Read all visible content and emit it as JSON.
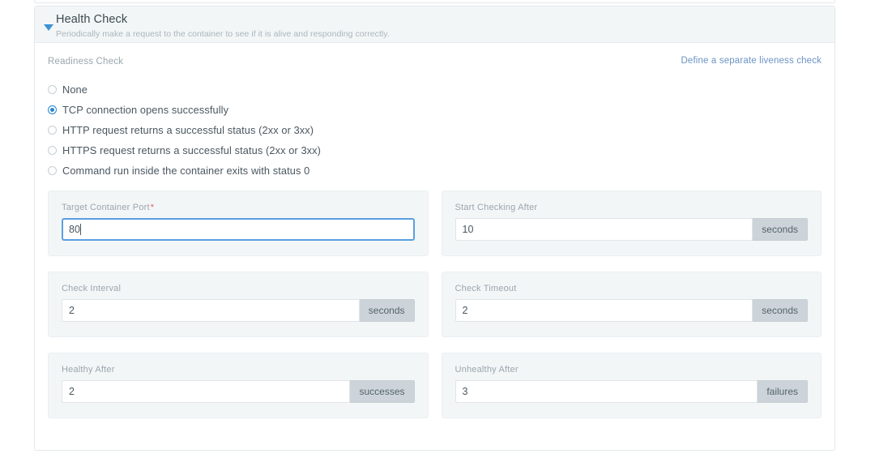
{
  "card": {
    "title": "Health Check",
    "subtitle": "Periodically make a request to the container to see if it is alive and responding correctly.",
    "collapse_icon": "triangle-down-icon",
    "collapsed": false
  },
  "section": {
    "label": "Readiness Check",
    "liveness_link": "Define a separate liveness check"
  },
  "probe_options": [
    {
      "label": "None",
      "selected": false
    },
    {
      "label": "TCP connection opens successfully",
      "selected": true
    },
    {
      "label": "HTTP request returns a successful status (2xx or 3xx)",
      "selected": false
    },
    {
      "label": "HTTPS request returns a successful status (2xx or 3xx)",
      "selected": false
    },
    {
      "label": "Command run inside the container exits with status 0",
      "selected": false
    }
  ],
  "fields": {
    "target_container_port": {
      "label": "Target Container Port",
      "required_marker": "*",
      "value": "80",
      "placeholder": "",
      "suffix": "",
      "focused": true
    },
    "start_checking_after": {
      "label": "Start Checking After",
      "value": "10",
      "placeholder": "",
      "suffix": "seconds",
      "focused": false
    },
    "check_interval": {
      "label": "Check Interval",
      "value": "2",
      "placeholder": "",
      "suffix": "seconds",
      "focused": false
    },
    "check_timeout": {
      "label": "Check Timeout",
      "value": "2",
      "placeholder": "",
      "suffix": "seconds",
      "focused": false
    },
    "healthy_after": {
      "label": "Healthy After",
      "value": "2",
      "placeholder": "",
      "suffix": "successes",
      "focused": false
    },
    "unhealthy_after": {
      "label": "Unhealthy After",
      "value": "3",
      "placeholder": "",
      "suffix": "failures",
      "focused": false
    }
  },
  "colors": {
    "accent_blue": "#2585d3",
    "link_blue": "#6b93c4",
    "panel_bg": "#f3f6f7",
    "suffix_bg": "#ccd4d9",
    "required_red": "#e0635f",
    "focus_border": "#5aa0e0"
  }
}
